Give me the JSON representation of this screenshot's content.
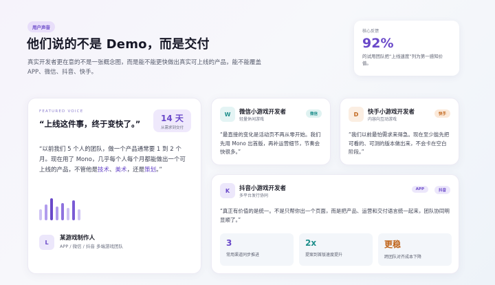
{
  "header": {
    "badge": "用户声音",
    "title": "他们说的不是 Demo，而是交付",
    "subtitle": "真实开发者更在意的不是一张概念图，而是能不能更快做出真实可上线的产品，能不能覆盖 APP、微信、抖音、快手。"
  },
  "stat": {
    "label": "核心反馈",
    "value": "92%",
    "desc": "的试用团队把“上线速度”列为第一感知价值。"
  },
  "featured": {
    "tag": "FEATURED VOICE",
    "title": "“上线这件事，终于变快了。”",
    "days_value": "14 天",
    "days_caption": "从需求到交付",
    "quote_a": "“以前我们 5 个人的团队，做一个产品通常要 1 到 2 个月。现在用了 Mono，几乎每个人每个月都能做出一个可上线的产品，不管他是",
    "quote_h1": "技术",
    "quote_b": "、",
    "quote_h2": "美术",
    "quote_c": "，还是",
    "quote_h3": "策划",
    "quote_d": "。”",
    "bars": [
      0.45,
      0.65,
      0.9,
      0.55,
      0.7,
      0.5,
      0.8,
      0.45
    ],
    "author_initial": "L",
    "author_name": "某游戏制作人",
    "author_role": "APP / 微信 / 抖音 多端游戏团队"
  },
  "wechat": {
    "initial": "W",
    "title": "微信小游戏开发者",
    "sub": "轻量休闲游戏",
    "pill": "微信",
    "quote": "“最直接的变化是活动页不再从零开始。我们先用 Mono 出首版，再补运营细节，节奏会快很多。”"
  },
  "kuaishou": {
    "initial": "D",
    "title": "快手小游戏开发者",
    "sub": "内容向互动游戏",
    "pill": "快手",
    "quote": "“我们以前最怕需求来得急。现在至少能先把可看的、可测的版本做出来，不会卡在空白阶段。”"
  },
  "douyin": {
    "initial": "K",
    "title": "抖音小游戏开发者",
    "sub": "多平台发行协同",
    "pills": [
      "APP",
      "抖音"
    ],
    "quote": "“真正有价值的是统一。不是只帮你出一个页面，而是把产品、运营和交付语言统一起来，团队协同明显顺了。”",
    "metrics": [
      {
        "value": "3",
        "desc": "常用渠道同步推进",
        "color": "#6a49c9"
      },
      {
        "value": "2x",
        "desc": "提案到首版速度提升",
        "color": "#1f8f8c"
      },
      {
        "value": "更稳",
        "desc": "跨团队对齐成本下降",
        "color": "#c0651b"
      }
    ]
  },
  "colors": {
    "accent": "#6a49c9",
    "teal": "#1f8f8c",
    "orange": "#c0651b"
  }
}
